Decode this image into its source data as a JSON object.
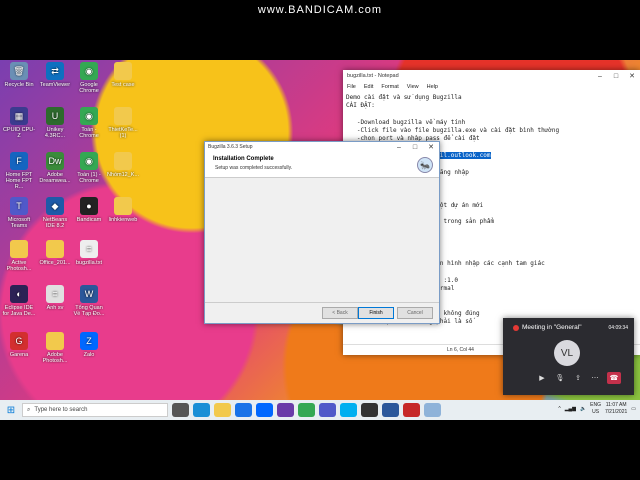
{
  "watermark": "www.BANDICAM.com",
  "desktop_icons": [
    {
      "label": "Recycle Bin",
      "icon": "recycle-bin-icon",
      "color": "#6a8fb5",
      "glyph": "🗑"
    },
    {
      "label": "TeamViewer",
      "icon": "teamviewer-icon",
      "color": "#0e70c0",
      "glyph": "⇄"
    },
    {
      "label": "Google Chrome",
      "icon": "chrome-icon",
      "color": "#34a853",
      "glyph": "◉"
    },
    {
      "label": "Test case",
      "icon": "folder-icon",
      "color": "#f2c94c",
      "glyph": ""
    },
    {
      "label": "CPUID CPU-Z",
      "icon": "cpuz-icon",
      "color": "#3b3b8f",
      "glyph": "▦"
    },
    {
      "label": "Unikey 4.3RC...",
      "icon": "unikey-icon",
      "color": "#2d6a2d",
      "glyph": "U"
    },
    {
      "label": "Toán - Chrome",
      "icon": "chrome-icon",
      "color": "#34a853",
      "glyph": "◉"
    },
    {
      "label": "ThietKeTe... (1)",
      "icon": "folder-icon",
      "color": "#f2c94c",
      "glyph": ""
    },
    {
      "label": "Home FPT Home FPT R...",
      "icon": "fpt-icon",
      "color": "#1565c0",
      "glyph": "F"
    },
    {
      "label": "Adobe Dreamwea...",
      "icon": "dreamweaver-icon",
      "color": "#3a8b3a",
      "glyph": "Dw"
    },
    {
      "label": "Toán (1) - Chrome",
      "icon": "chrome-icon",
      "color": "#34a853",
      "glyph": "◉"
    },
    {
      "label": "Microsoft Teams",
      "icon": "teams-icon",
      "color": "#5059c9",
      "glyph": "T"
    },
    {
      "label": "NetBeans IDE 8.2",
      "icon": "netbeans-icon",
      "color": "#1e5aa8",
      "glyph": "◆"
    },
    {
      "label": "Bandicam",
      "icon": "bandicam-icon",
      "color": "#222",
      "glyph": "●"
    },
    {
      "label": "Nhóm12_K...",
      "icon": "folder-icon",
      "color": "#f2c94c",
      "glyph": ""
    },
    {
      "label": "Active Photosh...",
      "icon": "folder-icon",
      "color": "#f2c94c",
      "glyph": ""
    },
    {
      "label": "Office_201...",
      "icon": "folder-icon",
      "color": "#f2c94c",
      "glyph": ""
    },
    {
      "label": "bugzilla.txt",
      "icon": "text-file-icon",
      "color": "#eeeeee",
      "glyph": "≡"
    },
    {
      "label": "linhkienweb",
      "icon": "folder-icon",
      "color": "#f2c94c",
      "glyph": ""
    },
    {
      "label": "Eclipse IDE for Java De...",
      "icon": "eclipse-icon",
      "color": "#2c2255",
      "glyph": "◐"
    },
    {
      "label": "Anh sv",
      "icon": "document-icon",
      "color": "#e0e0e0",
      "glyph": "≡"
    },
    {
      "label": "Tổng Quan Về Tạp Đo...",
      "icon": "word-icon",
      "color": "#2b579a",
      "glyph": "W"
    },
    {
      "label": "Garena",
      "icon": "garena-icon",
      "color": "#d32f2f",
      "glyph": "G"
    },
    {
      "label": "Adobe Photosh...",
      "icon": "folder-icon",
      "color": "#f2c94c",
      "glyph": ""
    },
    {
      "label": "Zalo",
      "icon": "zalo-icon",
      "color": "#0068ff",
      "glyph": "Z"
    }
  ],
  "notepad": {
    "title": "bugzilla.txt - Notepad",
    "menu": [
      "File",
      "Edit",
      "Format",
      "View",
      "Help"
    ],
    "lines": [
      "Demo cài đặt và sử dụng Bugzilla",
      "CÀI ĐẶT:",
      "",
      "   -Download bugzilla về máy tính",
      "   -Click file vào file bugzilla.exe và cài đặt bình thường",
      "   -chọn port và nhập pass để cài đặt",
      "",
      "",
      "      mail, name và pass đăng nhập",
      "      ất đầu với bugzilla",
      "",
      "   ugzilla",
      "   r chọn product để tạo một dự án mới",
      "   dự án: Tam giác",
      "   các thành phần cần test trong sản phẩm",
      "   ản của sản phẩm :1.0",
      "   cho dự án: Tam giác",
      "   g bao gồm :",
      "    Tên sản phẩm: Tam giác",
      "    Thành phần cần bug: Màn hình nhập các cạnh tam giác",
      "    Người báo cáo :Admin",
      "    Phiên bản của sản phẩm :1.0",
      "    Mức độ nghiêm trọng:Normal",
      "    Phần cứng thích ứng:PC",
      "    Hệ điều hành: Windows",
      "    lỗi : Dữ liệu nhập vào không đúng",
      "    lỗi : Cạnh A : Không phải là số"
    ],
    "smtp_prefix": "      ail server : ",
    "smtp_value": "smtp-mail.outlook.com",
    "status": "Ln 6, Col 44"
  },
  "setup": {
    "title": "Bugzilla 3.6.3 Setup",
    "heading": "Installation Complete",
    "subheading": "Setup was completed successfully.",
    "back": "< Back",
    "finish": "Finish",
    "cancel": "Cancel"
  },
  "teams": {
    "title": "Meeting in \"General\"",
    "time": "04:09:34",
    "initials": "VL"
  },
  "taskbar": {
    "search_placeholder": "Type here to search",
    "apps": [
      {
        "name": "task-view-icon",
        "color": "#555"
      },
      {
        "name": "edge-icon",
        "color": "#1a8fd6"
      },
      {
        "name": "file-explorer-icon",
        "color": "#f2c94c"
      },
      {
        "name": "store-icon",
        "color": "#1a73e8"
      },
      {
        "name": "zalo-icon",
        "color": "#0068ff"
      },
      {
        "name": "visual-studio-icon",
        "color": "#6a3ba8"
      },
      {
        "name": "chrome-icon",
        "color": "#34a853"
      },
      {
        "name": "teams-icon",
        "color": "#5059c9"
      },
      {
        "name": "skype-icon",
        "color": "#00aff0"
      },
      {
        "name": "terminal-icon",
        "color": "#333"
      },
      {
        "name": "word-icon",
        "color": "#2b579a"
      },
      {
        "name": "bandicam-icon",
        "color": "#c62828"
      },
      {
        "name": "notepad-icon",
        "color": "#8fb3d9"
      }
    ],
    "lang": "ENG",
    "region": "US",
    "time": "11:07 AM",
    "date": "7/21/2021"
  }
}
